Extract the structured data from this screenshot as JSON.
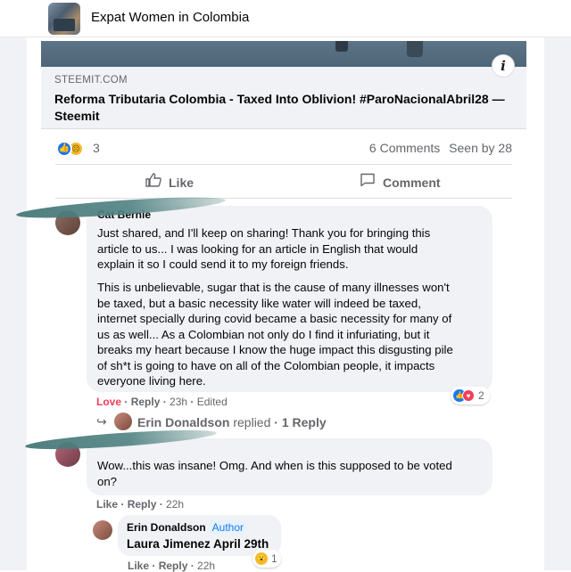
{
  "header": {
    "group_name": "Expat Women in Colombia"
  },
  "link": {
    "domain": "STEEMIT.COM",
    "title": "Reforma Tributaria Colombia - Taxed Into Oblivion! #ParoNacionalAbril28 — Steemit",
    "info_icon": "i"
  },
  "stats": {
    "reaction_count": "3",
    "comments": "6 Comments",
    "seen_by": "Seen by 28"
  },
  "actions": {
    "like": "Like",
    "comment": "Comment"
  },
  "comments": [
    {
      "name": "Cat Bernie",
      "paragraph1": [
        "Just shared, and I'll keep on sharing! Thank you for bringing this",
        "article to us... I was looking for an article in English that would",
        "explain it so I could send it to my foreign friends."
      ],
      "paragraph2": [
        "This is unbelievable, sugar that is the cause of many illnesses won't",
        "be taxed, but a basic necessity like water will indeed be taxed,",
        "internet specially during covid became a basic necessity for many of",
        "us as well... As a Colombian not only do I find it infuriating, but it",
        "breaks my heart because I know the huge impact this disgusting pile",
        "of sh*t is going to have on all of the Colombian people, it impacts",
        "everyone living here."
      ],
      "meta": {
        "reaction": "Love",
        "reply": "Reply",
        "time": "23h",
        "edited": "Edited"
      },
      "reaction_count": "2",
      "replies_summary": {
        "name": "Erin Donaldson",
        "replied": "replied",
        "count": "1 Reply"
      }
    },
    {
      "lines": [
        "Wow...this was insane! Omg. And when is this supposed to be voted",
        "on?"
      ],
      "meta": {
        "like": "Like",
        "reply": "Reply",
        "time": "22h"
      }
    }
  ],
  "reply": {
    "name": "Erin Donaldson",
    "badge": "Author",
    "text": "Laura Jimenez April 29th",
    "meta": {
      "like": "Like",
      "reply": "Reply",
      "time": "22h"
    },
    "reaction_count": "1"
  },
  "colors": {
    "facebook_blue": "#1877f2",
    "love_red": "#f33e58",
    "bubble_gray": "#f0f2f5",
    "brush_teal": "#477878"
  }
}
